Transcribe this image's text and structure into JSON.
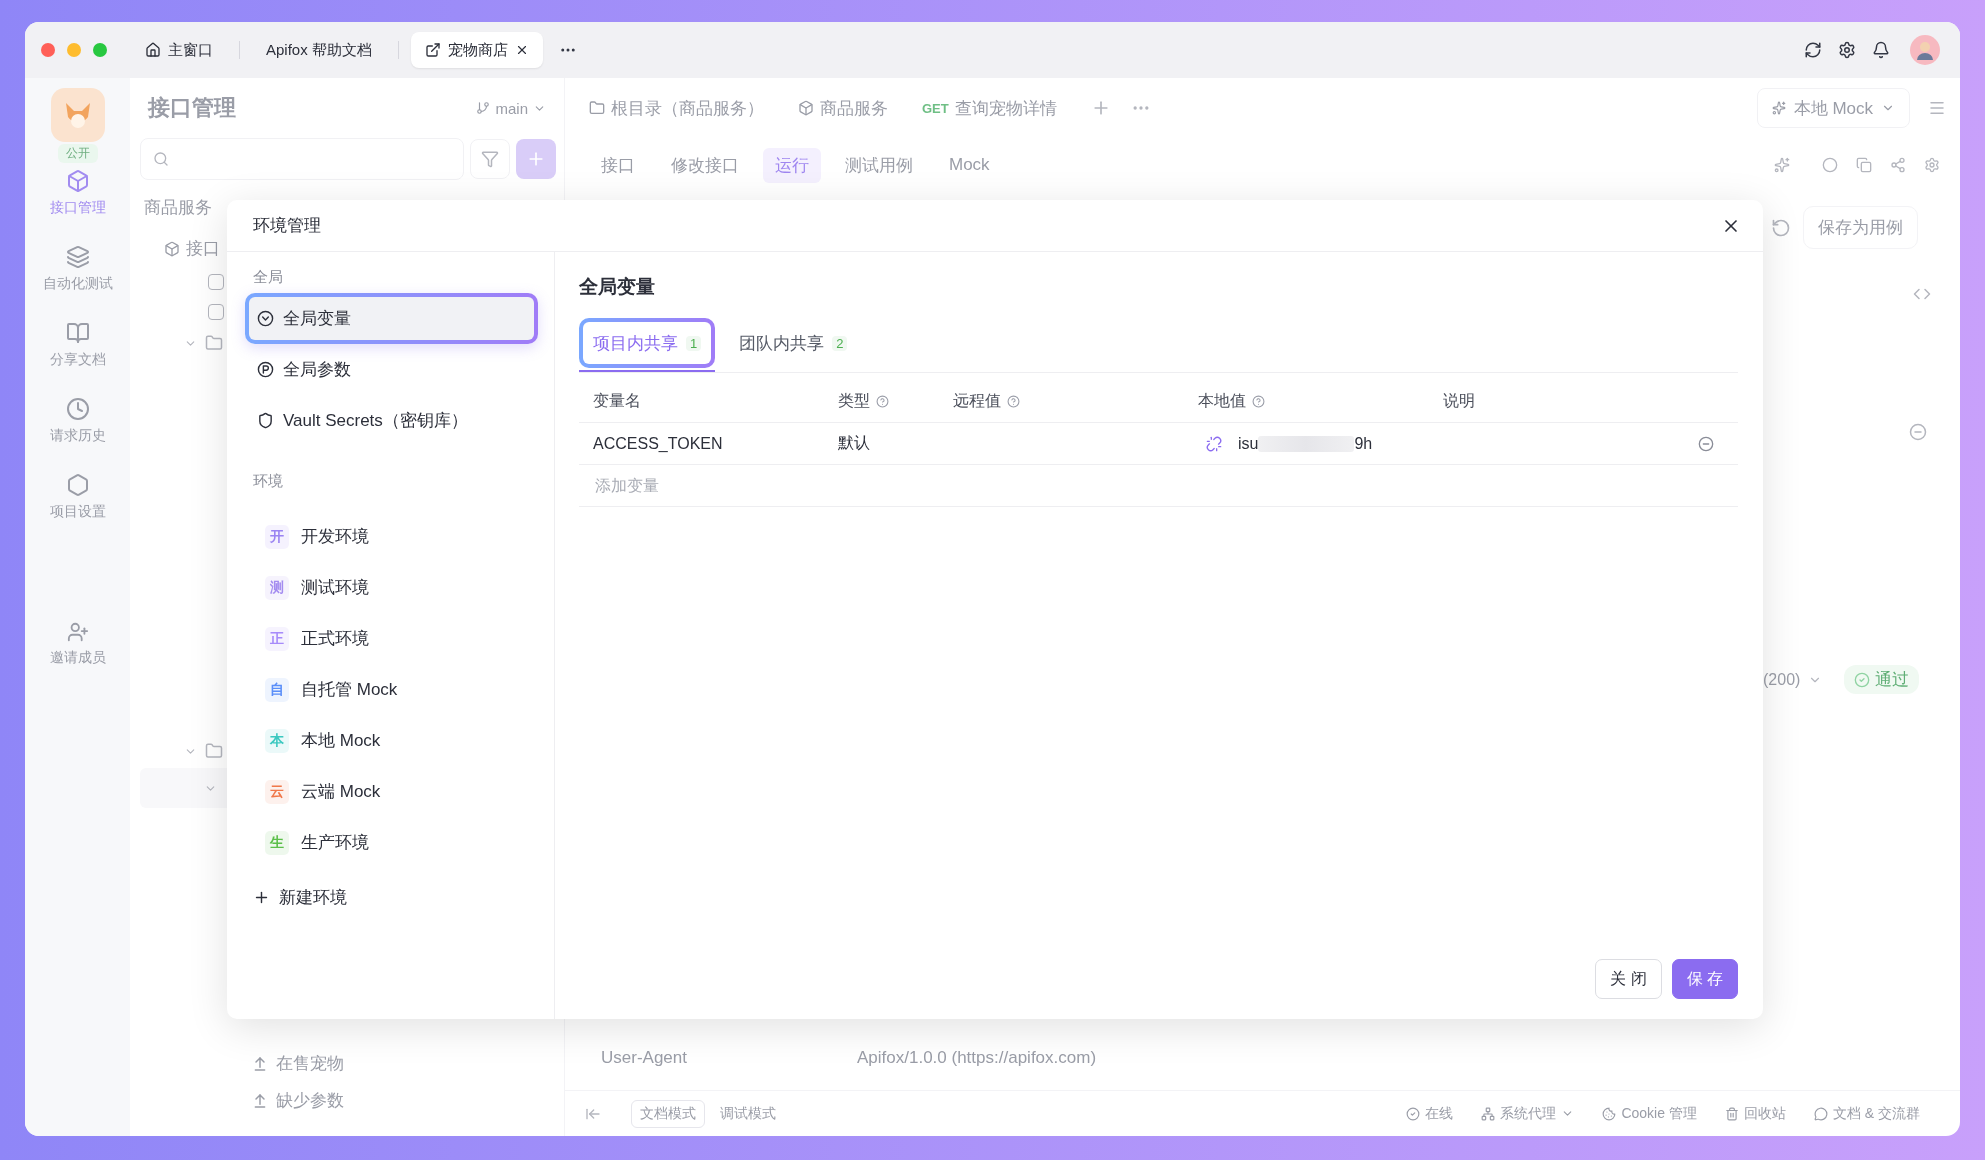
{
  "title_bar": {
    "tabs": [
      {
        "label": "主窗口",
        "kind": "home",
        "selected": false
      },
      {
        "label": "Apifox 帮助文档",
        "kind": "plain",
        "selected": false
      },
      {
        "label": "宠物商店",
        "kind": "project",
        "selected": true
      }
    ]
  },
  "rail": {
    "visibility": "公开",
    "items": [
      {
        "label": "接口管理",
        "kind": "api",
        "selected": true
      },
      {
        "label": "自动化测试",
        "kind": "auto",
        "selected": false
      },
      {
        "label": "分享文档",
        "kind": "docs",
        "selected": false
      },
      {
        "label": "请求历史",
        "kind": "history",
        "selected": false
      },
      {
        "label": "项目设置",
        "kind": "settings",
        "selected": false
      }
    ],
    "invite": "邀请成员"
  },
  "api_panel": {
    "title": "接口管理",
    "branch": "main",
    "tree_root": "商品服务",
    "tree_item": "接口",
    "cases": [
      "在售宠物",
      "缺少参数"
    ]
  },
  "doc_tabs": [
    {
      "label": "根目录（商品服务）",
      "kind": "folder"
    },
    {
      "label": "商品服务",
      "kind": "service"
    },
    {
      "label": "查询宠物详情",
      "kind": "api",
      "method": "GET"
    }
  ],
  "environment": "本地 Mock",
  "sub_tabs": [
    {
      "label": "接口",
      "selected": false
    },
    {
      "label": "修改接口",
      "selected": false
    },
    {
      "label": "运行",
      "selected": true
    },
    {
      "label": "测试用例",
      "selected": false
    },
    {
      "label": "Mock",
      "selected": false
    }
  ],
  "save_case": "保存为用例",
  "response": {
    "status": "(200)",
    "result": "通过"
  },
  "header_row": {
    "name": "User-Agent",
    "value": "Apifox/1.0.0 (https://apifox.com)"
  },
  "bottom_bar": {
    "modes": [
      {
        "label": "文档模式",
        "selected": true
      },
      {
        "label": "调试模式",
        "selected": false
      }
    ],
    "items": [
      {
        "label": "在线",
        "kind": "online"
      },
      {
        "label": "系统代理",
        "kind": "proxy"
      },
      {
        "label": "Cookie 管理",
        "kind": "cookie"
      },
      {
        "label": "回收站",
        "kind": "trash"
      },
      {
        "label": "文档 & 交流群",
        "kind": "community"
      }
    ]
  },
  "dialog": {
    "title": "环境管理",
    "global_label": "全局",
    "global_items": [
      {
        "label": "全局变量",
        "kind": "variable",
        "selected": true
      },
      {
        "label": "全局参数",
        "kind": "param",
        "selected": false
      },
      {
        "label": "Vault Secrets（密钥库）",
        "kind": "vault",
        "selected": false
      }
    ],
    "env_label": "环境",
    "environments": [
      {
        "badge": "开",
        "name": "开发环境",
        "color": "#9b84f2"
      },
      {
        "badge": "测",
        "name": "测试环境",
        "color": "#a48cf0"
      },
      {
        "badge": "正",
        "name": "正式环境",
        "color": "#a78bfa"
      },
      {
        "badge": "自",
        "name": "自托管 Mock",
        "color": "#5b8ff9"
      },
      {
        "badge": "本",
        "name": "本地 Mock",
        "color": "#3cc8c0"
      },
      {
        "badge": "云",
        "name": "云端 Mock",
        "color": "#f0784a"
      },
      {
        "badge": "生",
        "name": "生产环境",
        "color": "#5cbf4a"
      }
    ],
    "new_env": "新建环境",
    "heading": "全局变量",
    "tabs": [
      {
        "label": "项目内共享",
        "count": "1",
        "selected": true
      },
      {
        "label": "团队内共享",
        "count": "2",
        "selected": false
      }
    ],
    "columns": [
      {
        "label": "变量名",
        "help": false
      },
      {
        "label": "类型",
        "help": true
      },
      {
        "label": "远程值",
        "help": true
      },
      {
        "label": "本地值",
        "help": true
      },
      {
        "label": "说明",
        "help": false
      }
    ],
    "rows": [
      {
        "name": "ACCESS_TOKEN",
        "type": "默认",
        "local_start": "isu",
        "local_end": "9h"
      }
    ],
    "add_placeholder": "添加变量",
    "buttons": [
      {
        "label": "关 闭",
        "kind": "secondary"
      },
      {
        "label": "保 存",
        "kind": "primary"
      }
    ]
  }
}
